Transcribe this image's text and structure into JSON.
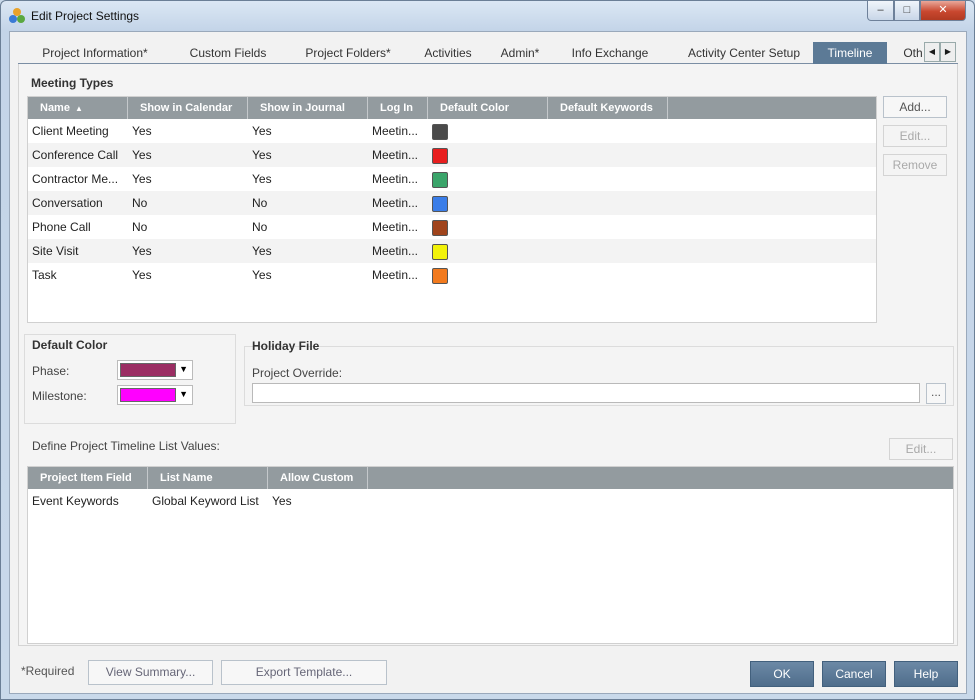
{
  "window": {
    "title": "Edit Project Settings"
  },
  "tabs": [
    {
      "label": "Project Information*"
    },
    {
      "label": "Custom Fields"
    },
    {
      "label": "Project Folders*"
    },
    {
      "label": "Activities"
    },
    {
      "label": "Admin*"
    },
    {
      "label": "Info Exchange"
    },
    {
      "label": "Activity Center Setup"
    },
    {
      "label": "Timeline"
    },
    {
      "label": "Oth"
    }
  ],
  "meeting_types": {
    "title": "Meeting Types",
    "columns": [
      "Name",
      "Show in Calendar",
      "Show in Journal",
      "Log In",
      "Default Color",
      "Default Keywords"
    ],
    "rows": [
      {
        "name": "Client Meeting",
        "calendar": "Yes",
        "journal": "Yes",
        "log_in": "Meetin...",
        "color": "#4a4a4a"
      },
      {
        "name": "Conference Call",
        "calendar": "Yes",
        "journal": "Yes",
        "log_in": "Meetin...",
        "color": "#e81e1e"
      },
      {
        "name": "Contractor Me...",
        "calendar": "Yes",
        "journal": "Yes",
        "log_in": "Meetin...",
        "color": "#3aa46a"
      },
      {
        "name": "Conversation",
        "calendar": "No",
        "journal": "No",
        "log_in": "Meetin...",
        "color": "#3a7de8"
      },
      {
        "name": "Phone Call",
        "calendar": "No",
        "journal": "No",
        "log_in": "Meetin...",
        "color": "#a0441c"
      },
      {
        "name": "Site Visit",
        "calendar": "Yes",
        "journal": "Yes",
        "log_in": "Meetin...",
        "color": "#f2f20a"
      },
      {
        "name": "Task",
        "calendar": "Yes",
        "journal": "Yes",
        "log_in": "Meetin...",
        "color": "#f27a1e"
      }
    ],
    "buttons": {
      "add": "Add...",
      "edit": "Edit...",
      "remove": "Remove"
    }
  },
  "default_color": {
    "title": "Default Color",
    "phase_label": "Phase:",
    "phase_color": "#9b2e63",
    "milestone_label": "Milestone:",
    "milestone_color": "#ff00ff"
  },
  "holiday_file": {
    "title": "Holiday File",
    "override_label": "Project Override:",
    "value": "",
    "browse": "..."
  },
  "timeline_list": {
    "label": "Define Project Timeline List Values:",
    "edit": "Edit...",
    "columns": [
      "Project Item Field",
      "List Name",
      "Allow Custom"
    ],
    "rows": [
      {
        "field": "Event Keywords",
        "list": "Global Keyword List",
        "custom": "Yes"
      }
    ]
  },
  "footer": {
    "required": "*Required",
    "view_summary": "View Summary...",
    "export_template": "Export Template...",
    "ok": "OK",
    "cancel": "Cancel",
    "help": "Help"
  }
}
